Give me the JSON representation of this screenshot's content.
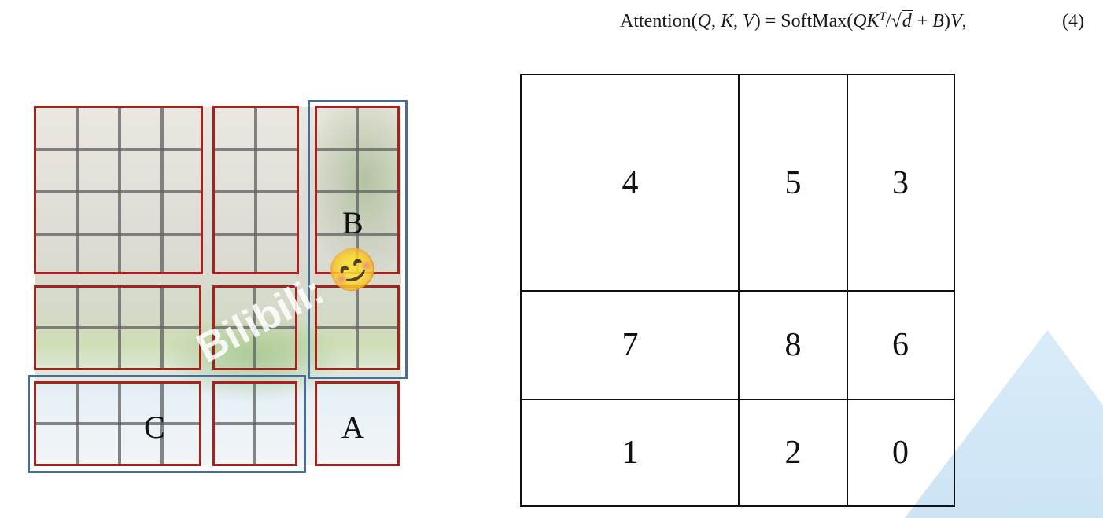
{
  "formula": {
    "lhs": "Attention(",
    "q": "Q",
    "k": "K",
    "v": "V",
    "eq": ") = SoftMax(",
    "qk": "QK",
    "t": "T",
    "slash": "/√",
    "d": "d",
    "plus": " + ",
    "b": "B",
    "close": ")",
    "v2": "V",
    "comma": ",",
    "number": "(4)"
  },
  "image_panel": {
    "labels": {
      "a": "A",
      "b": "B",
      "c": "C"
    },
    "watermark": "Bilibili: 😊"
  },
  "mask_grid": {
    "rows": [
      [
        "4",
        "5",
        "3"
      ],
      [
        "7",
        "8",
        "6"
      ],
      [
        "1",
        "2",
        "0"
      ]
    ]
  },
  "colors": {
    "window_border": "#a5231c",
    "group_border": "#4a6d93",
    "grid_line": "#111111"
  }
}
